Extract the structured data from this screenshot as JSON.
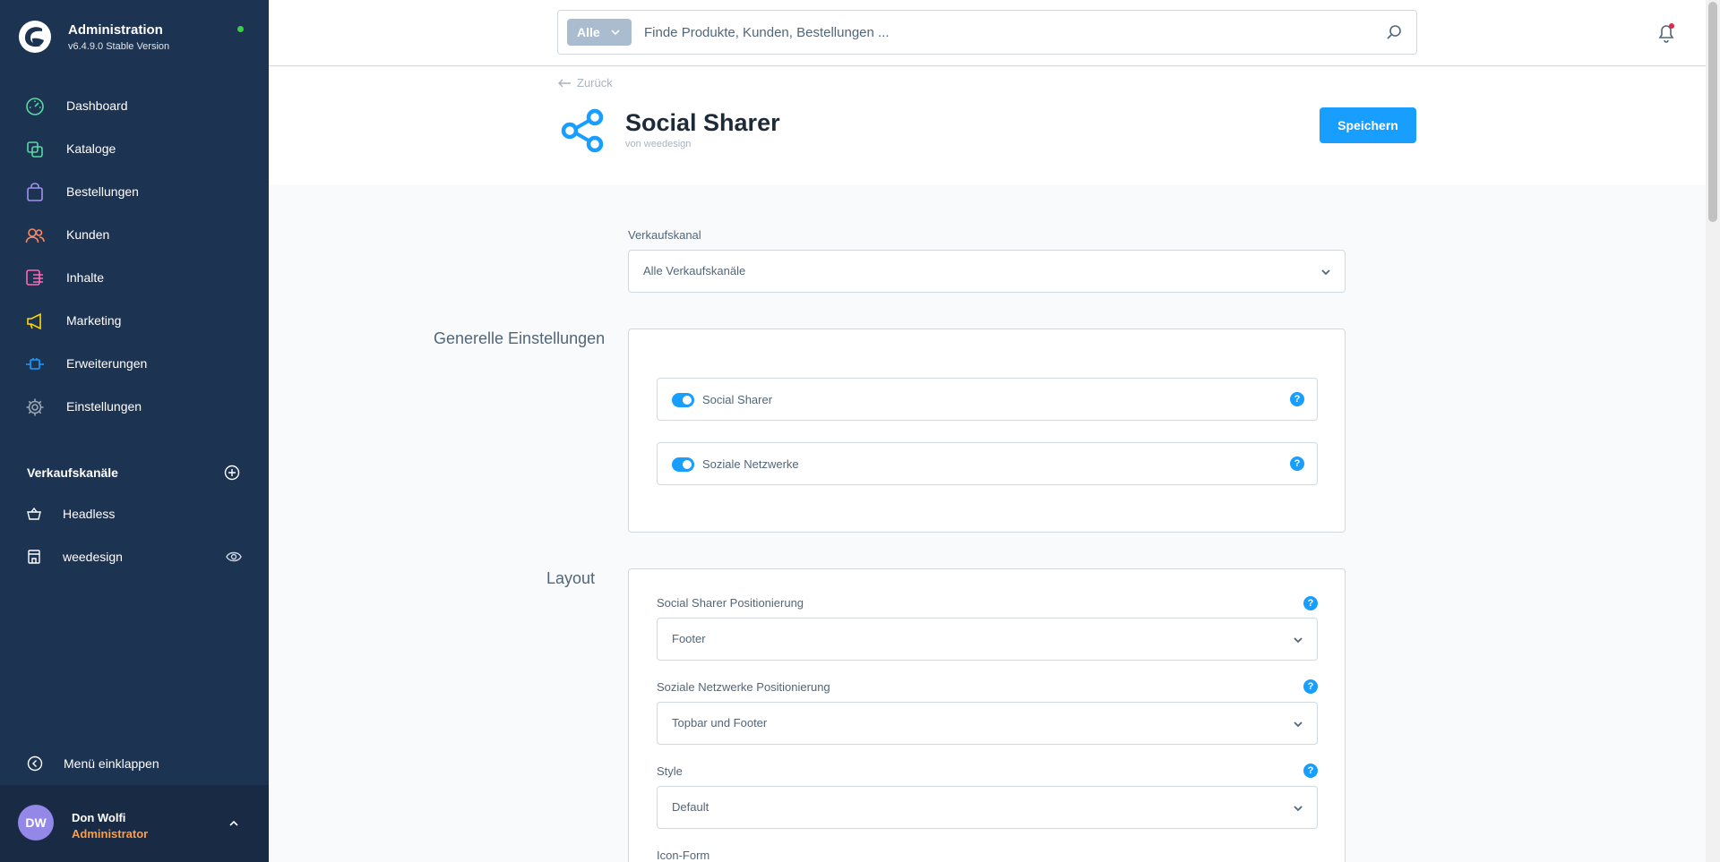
{
  "app": {
    "title": "Administration",
    "version": "v6.4.9.0 Stable Version"
  },
  "sidebar": {
    "items": [
      {
        "label": "Dashboard",
        "icon": "dashboard-icon",
        "color": "#57d9a3"
      },
      {
        "label": "Kataloge",
        "icon": "catalog-icon",
        "color": "#57d9a3"
      },
      {
        "label": "Bestellungen",
        "icon": "orders-icon",
        "color": "#a092f0"
      },
      {
        "label": "Kunden",
        "icon": "customers-icon",
        "color": "#f88962"
      },
      {
        "label": "Inhalte",
        "icon": "content-icon",
        "color": "#ff68b4"
      },
      {
        "label": "Marketing",
        "icon": "marketing-icon",
        "color": "#ffd700"
      },
      {
        "label": "Erweiterungen",
        "icon": "extensions-icon",
        "color": "#189eff"
      },
      {
        "label": "Einstellungen",
        "icon": "settings-icon",
        "color": "#9aa8b5"
      }
    ],
    "channels_title": "Verkaufskanäle",
    "channels": [
      {
        "label": "Headless"
      },
      {
        "label": "weedesign"
      }
    ],
    "collapse_label": "Menü einklappen"
  },
  "user": {
    "initials": "DW",
    "name": "Don Wolfi",
    "role": "Administrator"
  },
  "search": {
    "type_label": "Alle",
    "placeholder": "Finde Produkte, Kunden, Bestellungen ..."
  },
  "page": {
    "back_label": "Zurück",
    "title": "Social Sharer",
    "author": "von weedesign",
    "save_label": "Speichern"
  },
  "form": {
    "sales_channel_label": "Verkaufskanal",
    "sales_channel_value": "Alle Verkaufskanäle",
    "general_title": "Generelle Einstellungen",
    "switches": [
      {
        "label": "Social Sharer",
        "enabled": true
      },
      {
        "label": "Soziale Netzwerke",
        "enabled": true
      }
    ],
    "layout_title": "Layout",
    "selects": [
      {
        "label": "Social Sharer Positionierung",
        "value": "Footer"
      },
      {
        "label": "Soziale Netzwerke Positionierung",
        "value": "Topbar und Footer"
      },
      {
        "label": "Style",
        "value": "Default"
      }
    ],
    "icon_form_label": "Icon-Form",
    "help_glyph": "?"
  }
}
